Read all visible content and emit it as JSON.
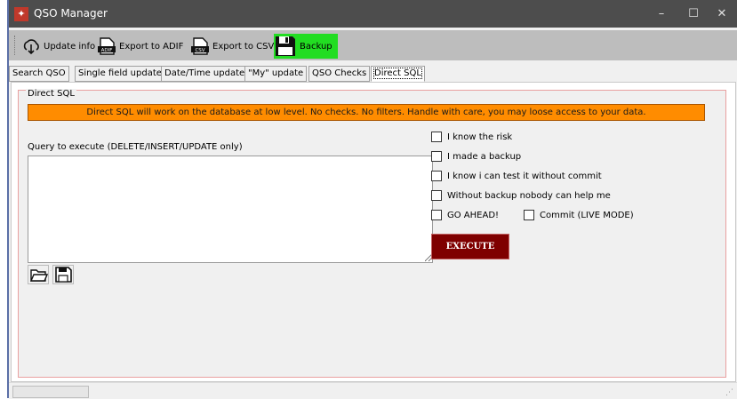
{
  "window": {
    "title": "QSO Manager",
    "minimize_glyph": "–",
    "maximize_glyph": "☐",
    "close_glyph": "✕"
  },
  "toolbar": {
    "buttons": [
      {
        "label": "Update info",
        "icon": "cloud-download-icon"
      },
      {
        "label": "Export to ADIF",
        "icon": "adif-file-icon",
        "icon_text": "ADIF"
      },
      {
        "label": "Export to CSV",
        "icon": "csv-file-icon",
        "icon_text": "CSV"
      },
      {
        "label": "Backup",
        "icon": "floppy-disk-icon",
        "highlight": "#22dd22"
      }
    ]
  },
  "tabs": [
    {
      "label": "Search QSO",
      "active": false
    },
    {
      "label": "Single field update",
      "active": false
    },
    {
      "label": "Date/Time update",
      "active": false
    },
    {
      "label": "\"My\" update",
      "active": false
    },
    {
      "label": "QSO Checks",
      "active": false
    },
    {
      "label": "Direct SQL",
      "active": true
    }
  ],
  "direct_sql": {
    "group_title": "Direct SQL",
    "warning": "Direct SQL will work on the database at low level. No checks. No filters. Handle with care, you may loose access to your data.",
    "query_label": "Query to execute (DELETE/INSERT/UPDATE only)",
    "query_value": "",
    "checkboxes": [
      {
        "label": "I know the risk",
        "checked": false
      },
      {
        "label": "I made a backup",
        "checked": false
      },
      {
        "label": "I know i can test it without commit",
        "checked": false
      },
      {
        "label": "Without backup nobody can help me",
        "checked": false
      },
      {
        "label": "GO AHEAD!",
        "checked": false
      },
      {
        "label": "Commit (LIVE MODE)",
        "checked": false
      }
    ],
    "execute_label": "EXECUTE"
  },
  "colors": {
    "warning_bg": "#ff8c00",
    "execute_bg": "#7f0000",
    "backup_bg": "#22dd22",
    "group_border": "#e9a0a0",
    "titlebar": "#4d4d4d"
  }
}
